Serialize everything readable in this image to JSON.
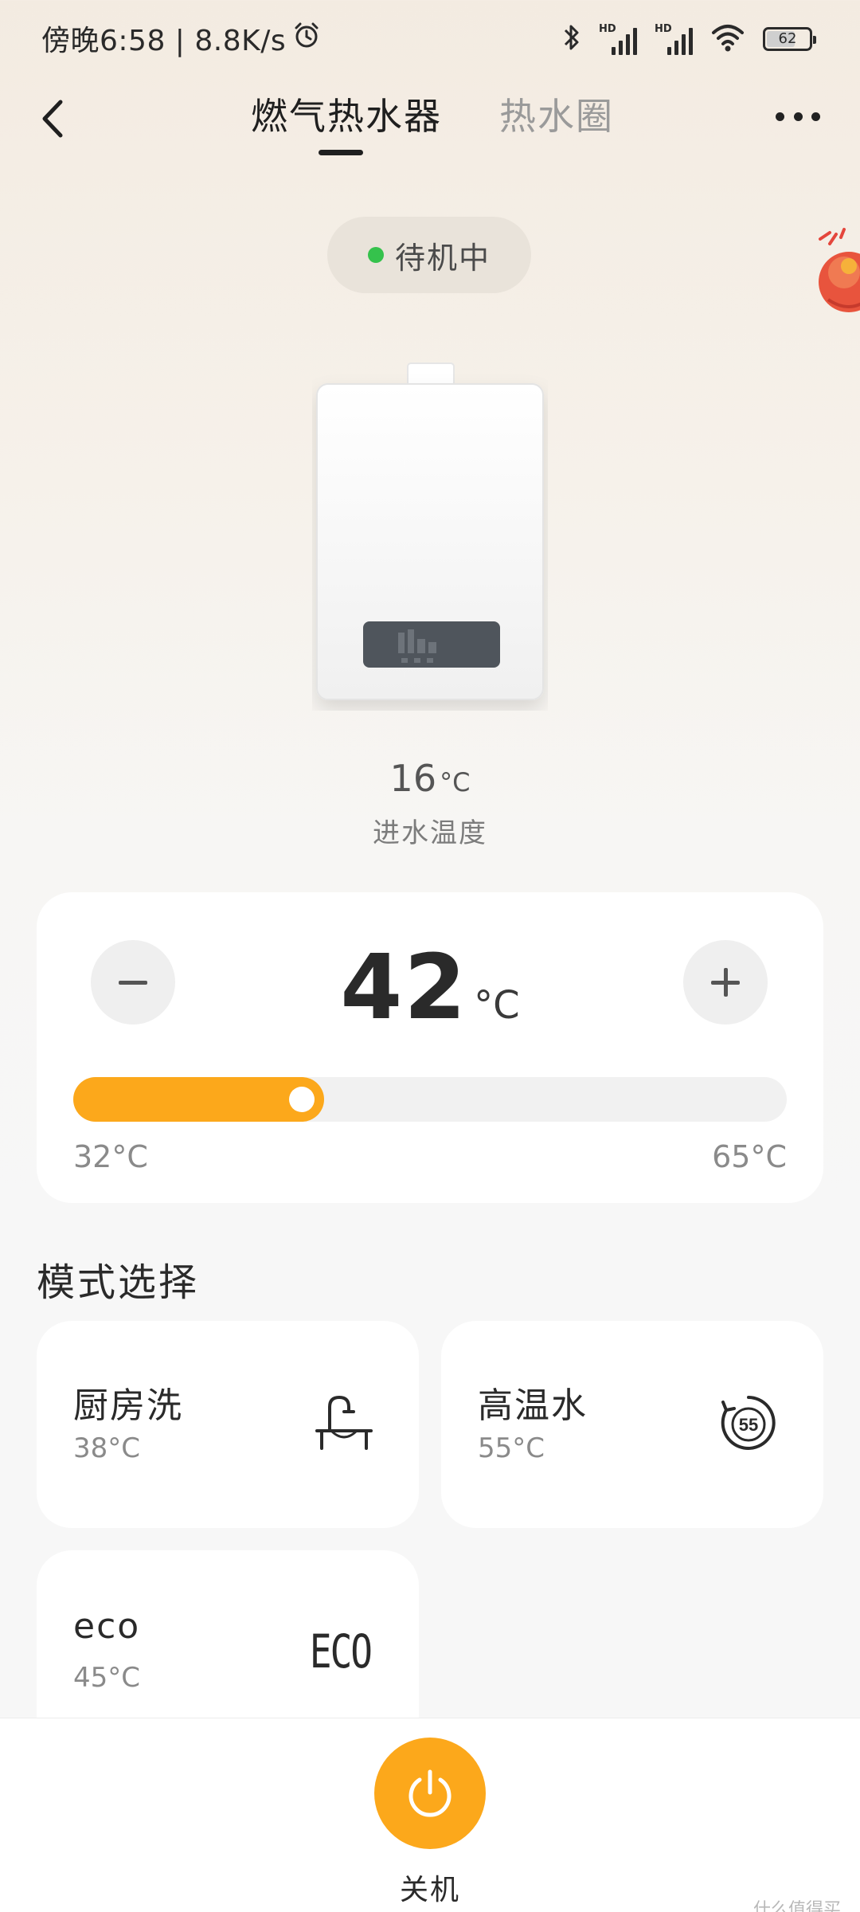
{
  "status_bar": {
    "time_speed": "傍晚6:58 | 8.8K/s",
    "battery": "62",
    "hd1": "HD",
    "hd2": "HD"
  },
  "header": {
    "tabs": [
      {
        "label": "燃气热水器",
        "active": true
      },
      {
        "label": "热水圈",
        "active": false
      }
    ]
  },
  "device": {
    "status": "待机中",
    "status_color": "#35c24c",
    "inlet_temp_value": "16",
    "inlet_temp_unit": "°C",
    "inlet_temp_label": "进水温度"
  },
  "temperature": {
    "set_value": "42",
    "unit": "°C",
    "min_label": "32°C",
    "max_label": "65°C",
    "min": 32,
    "max": 65,
    "current": 42
  },
  "modes": {
    "title": "模式选择",
    "items": [
      {
        "name": "厨房洗",
        "temp": "38°C",
        "icon": "faucet-icon"
      },
      {
        "name": "高温水",
        "temp": "55°C",
        "icon": "high-temp-55-icon"
      },
      {
        "name": "eco",
        "temp": "45°C",
        "icon": "eco-icon",
        "icon_text": "ECO"
      }
    ]
  },
  "bottom": {
    "power_label": "关机",
    "watermark": "什么值得买"
  },
  "colors": {
    "accent": "#fca81b",
    "status_green": "#35c24c"
  }
}
